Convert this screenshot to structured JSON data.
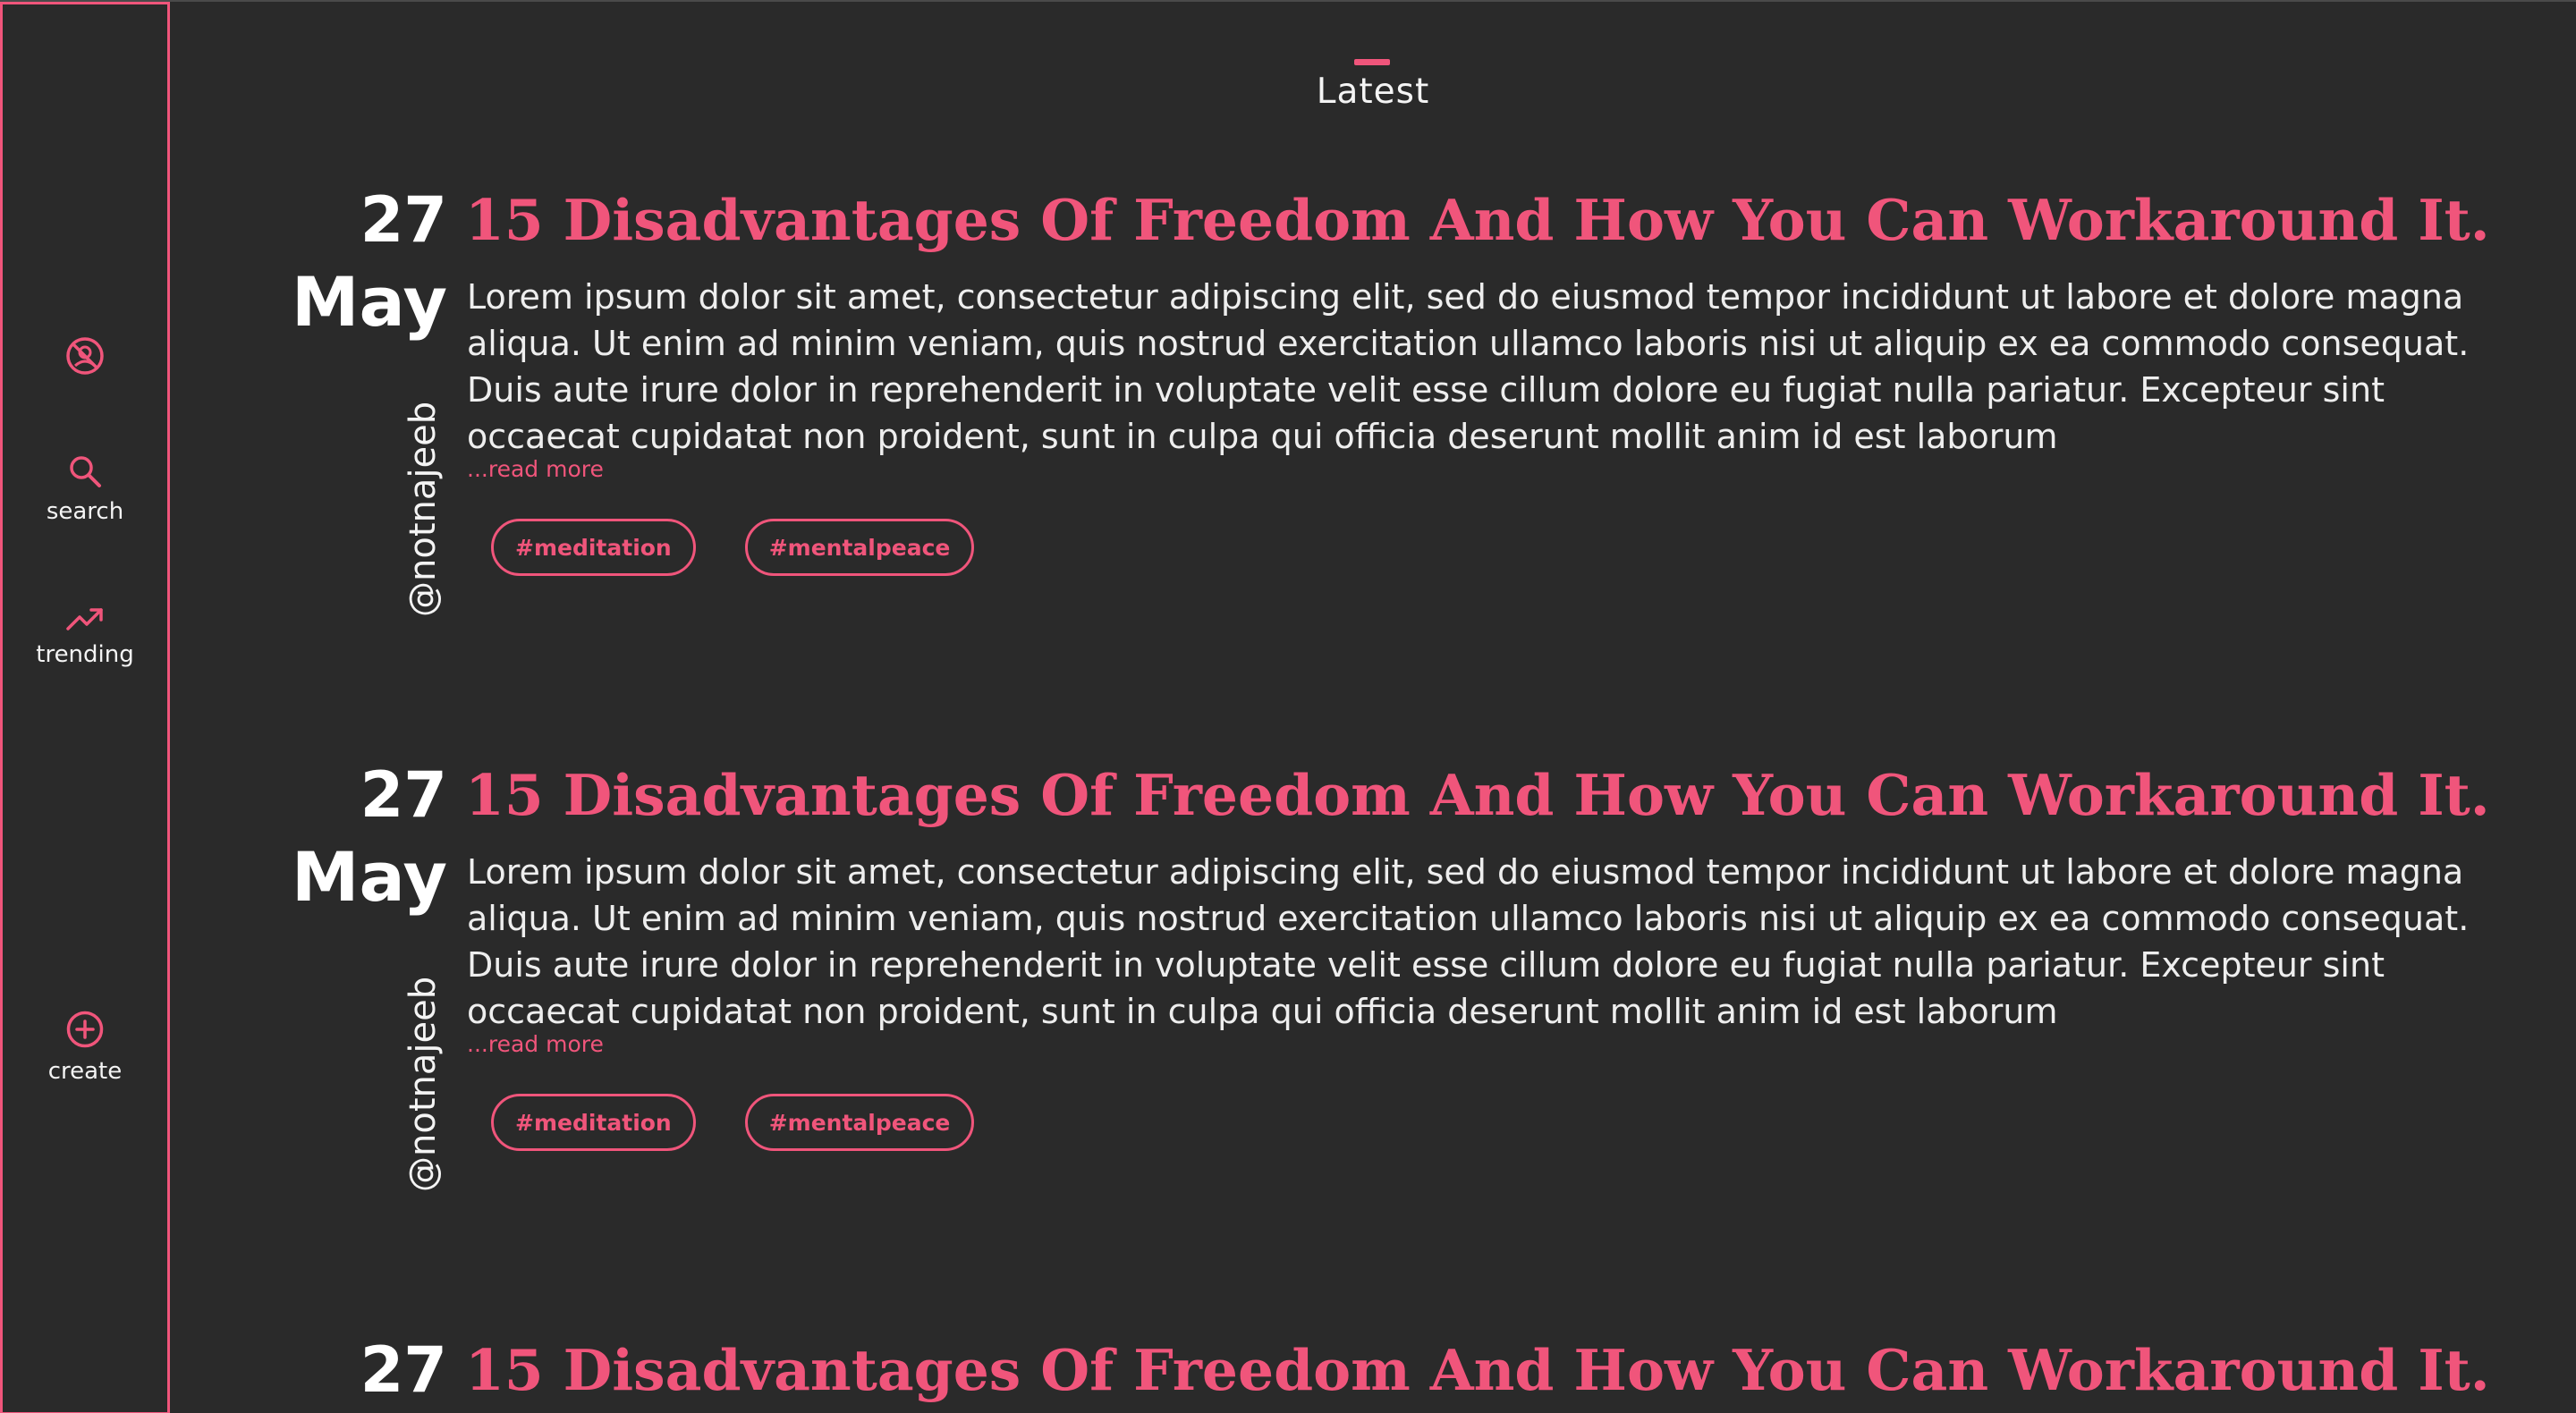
{
  "sidebar": {
    "items": [
      {
        "icon": "cancelled-profile-icon",
        "label": ""
      },
      {
        "icon": "search-icon",
        "label": "search"
      },
      {
        "icon": "trending-icon",
        "label": "trending"
      },
      {
        "icon": "plus-circle-icon",
        "label": "create"
      }
    ]
  },
  "header": {
    "title": "Latest"
  },
  "posts": [
    {
      "day": "27",
      "month": "May",
      "author": "@notnajeeb",
      "title": "15 Disadvantages Of Freedom And How You Can Workaround It.",
      "body": "Lorem ipsum dolor sit amet, consectetur adipiscing elit, sed do eiusmod tempor incididunt ut labore et dolore magna aliqua. Ut enim ad minim veniam, quis nostrud exercitation ullamco laboris nisi ut aliquip ex ea commodo consequat. Duis aute irure dolor in reprehenderit in voluptate velit esse cillum dolore eu fugiat nulla pariatur. Excepteur sint occaecat cupidatat non proident, sunt in culpa qui officia deserunt mollit anim id est laborum",
      "read_more": "...read more",
      "tags": [
        "#meditation",
        "#mentalpeace"
      ]
    },
    {
      "day": "27",
      "month": "May",
      "author": "@notnajeeb",
      "title": "15 Disadvantages Of Freedom And How You Can Workaround It.",
      "body": "Lorem ipsum dolor sit amet, consectetur adipiscing elit, sed do eiusmod tempor incididunt ut labore et dolore magna aliqua. Ut enim ad minim veniam, quis nostrud exercitation ullamco laboris nisi ut aliquip ex ea commodo consequat. Duis aute irure dolor in reprehenderit in voluptate velit esse cillum dolore eu fugiat nulla pariatur. Excepteur sint occaecat cupidatat non proident, sunt in culpa qui officia deserunt mollit anim id est laborum",
      "read_more": "...read more",
      "tags": [
        "#meditation",
        "#mentalpeace"
      ]
    },
    {
      "day": "27",
      "title": "15 Disadvantages Of Freedom And How You Can Workaround It."
    }
  ],
  "colors": {
    "background": "#2a2a2a",
    "accent": "#f0557b",
    "text": "#f4f4f4"
  }
}
